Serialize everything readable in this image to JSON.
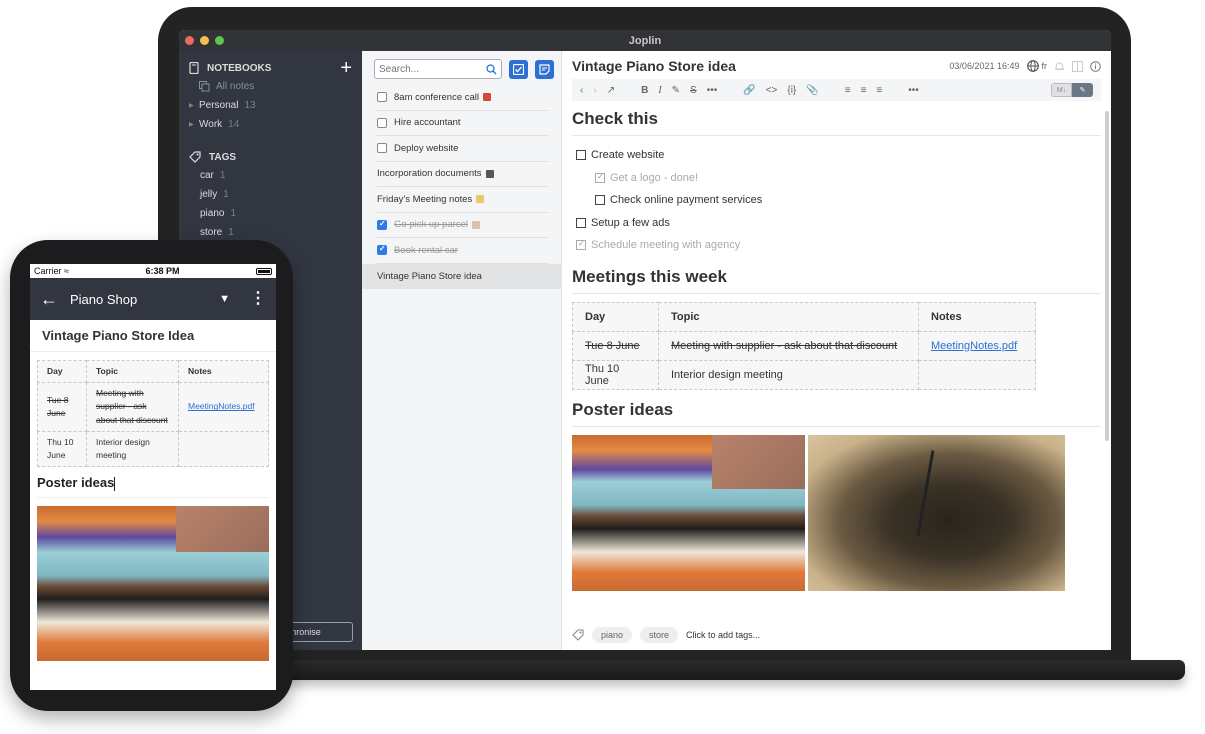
{
  "window": {
    "title": "Joplin",
    "traffic_colors": [
      "#ec6a5e",
      "#f4bf4f",
      "#61c554"
    ]
  },
  "sidebar": {
    "notebooks_label": "NOTEBOOKS",
    "all_notes_label": "All notes",
    "notebooks": [
      {
        "name": "Personal",
        "count": "13"
      },
      {
        "name": "Work",
        "count": "14"
      }
    ],
    "tags_label": "TAGS",
    "tags": [
      {
        "name": "car",
        "count": "1"
      },
      {
        "name": "jelly",
        "count": "1"
      },
      {
        "name": "piano",
        "count": "1"
      },
      {
        "name": "store",
        "count": "1"
      }
    ],
    "sync_label": "Synchronise"
  },
  "notelist": {
    "search_placeholder": "Search...",
    "notes": [
      {
        "title": "8am conference call",
        "todo": true,
        "done": false,
        "emoji_color": "#d9463a"
      },
      {
        "title": "Hire accountant",
        "todo": true,
        "done": false
      },
      {
        "title": "Deploy website",
        "todo": true,
        "done": false
      },
      {
        "title": "Incorporation documents",
        "todo": false,
        "emoji_color": "#555"
      },
      {
        "title": "Friday's Meeting notes",
        "todo": false,
        "emoji_color": "#e8c76a"
      },
      {
        "title": "Go pick up parcel",
        "todo": true,
        "done": true,
        "emoji_color": "#c9a27a"
      },
      {
        "title": "Book rental car",
        "todo": true,
        "done": true
      },
      {
        "title": "Vintage Piano Store idea",
        "todo": false,
        "selected": true
      }
    ]
  },
  "editor": {
    "title": "Vintage Piano Store idea",
    "date": "03/06/2021 16:49",
    "language": "fr",
    "heading_check": "Check this",
    "checklist": [
      {
        "text": "Create website",
        "done": false,
        "level": 0
      },
      {
        "text": "Get a logo - done!",
        "done": true,
        "level": 1
      },
      {
        "text": "Check online payment services",
        "done": false,
        "level": 1
      },
      {
        "text": "Setup a few ads",
        "done": false,
        "level": 0
      },
      {
        "text": "Schedule meeting with agency",
        "done": true,
        "level": 0
      }
    ],
    "heading_meetings": "Meetings this week",
    "table": {
      "headers": [
        "Day",
        "Topic",
        "Notes"
      ],
      "rows": [
        {
          "day": "Tue 8 June",
          "topic": "Meeting with supplier - ask about that discount",
          "notes": "MeetingNotes.pdf",
          "struck": true
        },
        {
          "day": "Thu 10 June",
          "topic": "Interior design meeting",
          "notes": "",
          "struck": false
        }
      ]
    },
    "heading_poster": "Poster ideas",
    "images": [
      "piano-photo",
      "turntable-photo"
    ],
    "tags": [
      "piano",
      "store"
    ],
    "add_tags_label": "Click to add tags...",
    "toggle_md_label": "M↓"
  },
  "phone": {
    "carrier": "Carrier",
    "time": "6:38 PM",
    "notebook": "Piano Shop",
    "note_title": "Vintage Piano Store Idea",
    "table": {
      "headers": [
        "Day",
        "Topic",
        "Notes"
      ],
      "rows": [
        {
          "day": "Tue 8 June",
          "topic": "Meeting with supplier - ask about that discount",
          "notes": "MeetingNotes.pdf",
          "struck": true
        },
        {
          "day": "Thu 10 June",
          "topic": "Interior design meeting",
          "notes": "",
          "struck": false
        }
      ]
    },
    "heading_poster": "Poster ideas"
  }
}
